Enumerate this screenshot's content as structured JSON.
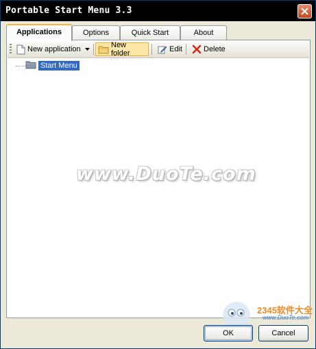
{
  "window": {
    "title": "Portable Start Menu 3.3"
  },
  "tabs": [
    {
      "label": "Applications",
      "active": true
    },
    {
      "label": "Options",
      "active": false
    },
    {
      "label": "Quick Start",
      "active": false
    },
    {
      "label": "About",
      "active": false
    }
  ],
  "toolbar": {
    "new_application": "New application",
    "new_folder": "New folder",
    "edit": "Edit",
    "delete": "Delete"
  },
  "tree": {
    "root": "Start Menu"
  },
  "watermark": {
    "text": "www.DuoTe.com"
  },
  "logo": {
    "text": "2345软件大全",
    "url": "www.DuoTe.com"
  },
  "buttons": {
    "ok": "OK",
    "cancel": "Cancel"
  },
  "colors": {
    "selection": "#316ac5",
    "tab_accent": "#f9b33f",
    "hot": "#fbe5a7",
    "close": "#c4461e"
  }
}
